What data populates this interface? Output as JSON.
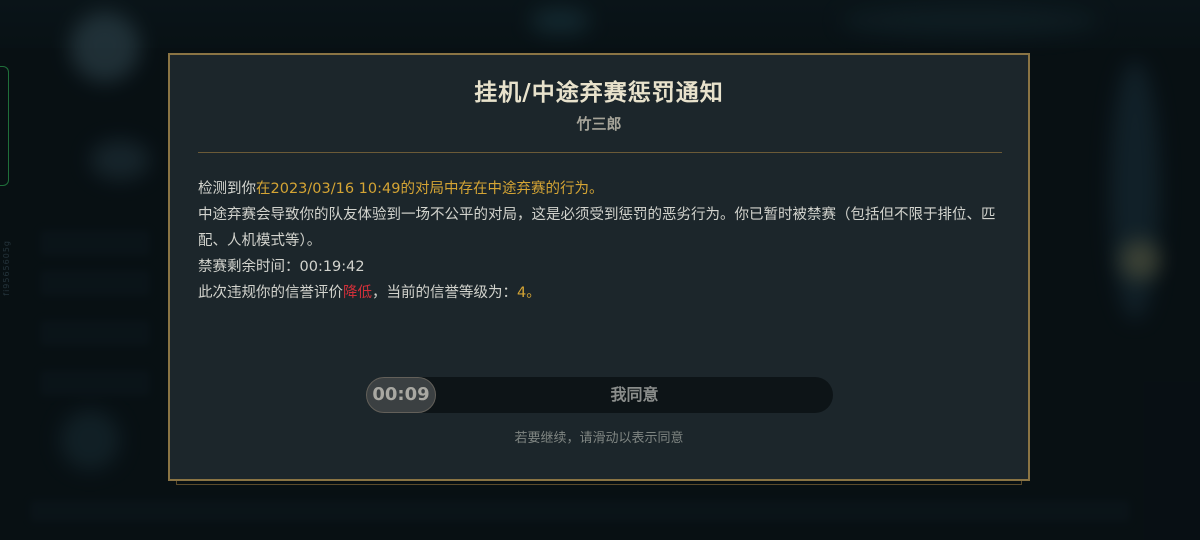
{
  "side_label": "fi9565605g",
  "dialog": {
    "title": "挂机/中途弃赛惩罚通知",
    "player_name": "竹三郎",
    "line1": {
      "prefix": "检测到你",
      "highlight": "在2023/03/16 10:49的对局中存在中途弃赛的行为。"
    },
    "line2": "中途弃赛会导致你的队友体验到一场不公平的对局，这是必须受到惩罚的恶劣行为。你已暂时被禁赛（包括但不限于排位、匹配、人机模式等）。",
    "line3": {
      "label": "禁赛剩余时间：",
      "value": "00:19:42"
    },
    "line4": {
      "prefix": "此次违规你的信誉评价",
      "action": "降低",
      "middle": "，当前的信誉等级为：",
      "level": "4。"
    },
    "slider": {
      "timer": "00:09",
      "label": "我同意"
    },
    "hint": "若要继续，请滑动以表示同意"
  },
  "colors": {
    "border_gold": "#8a7444",
    "highlight_gold": "#d4a434",
    "highlight_red": "#d0303a"
  }
}
